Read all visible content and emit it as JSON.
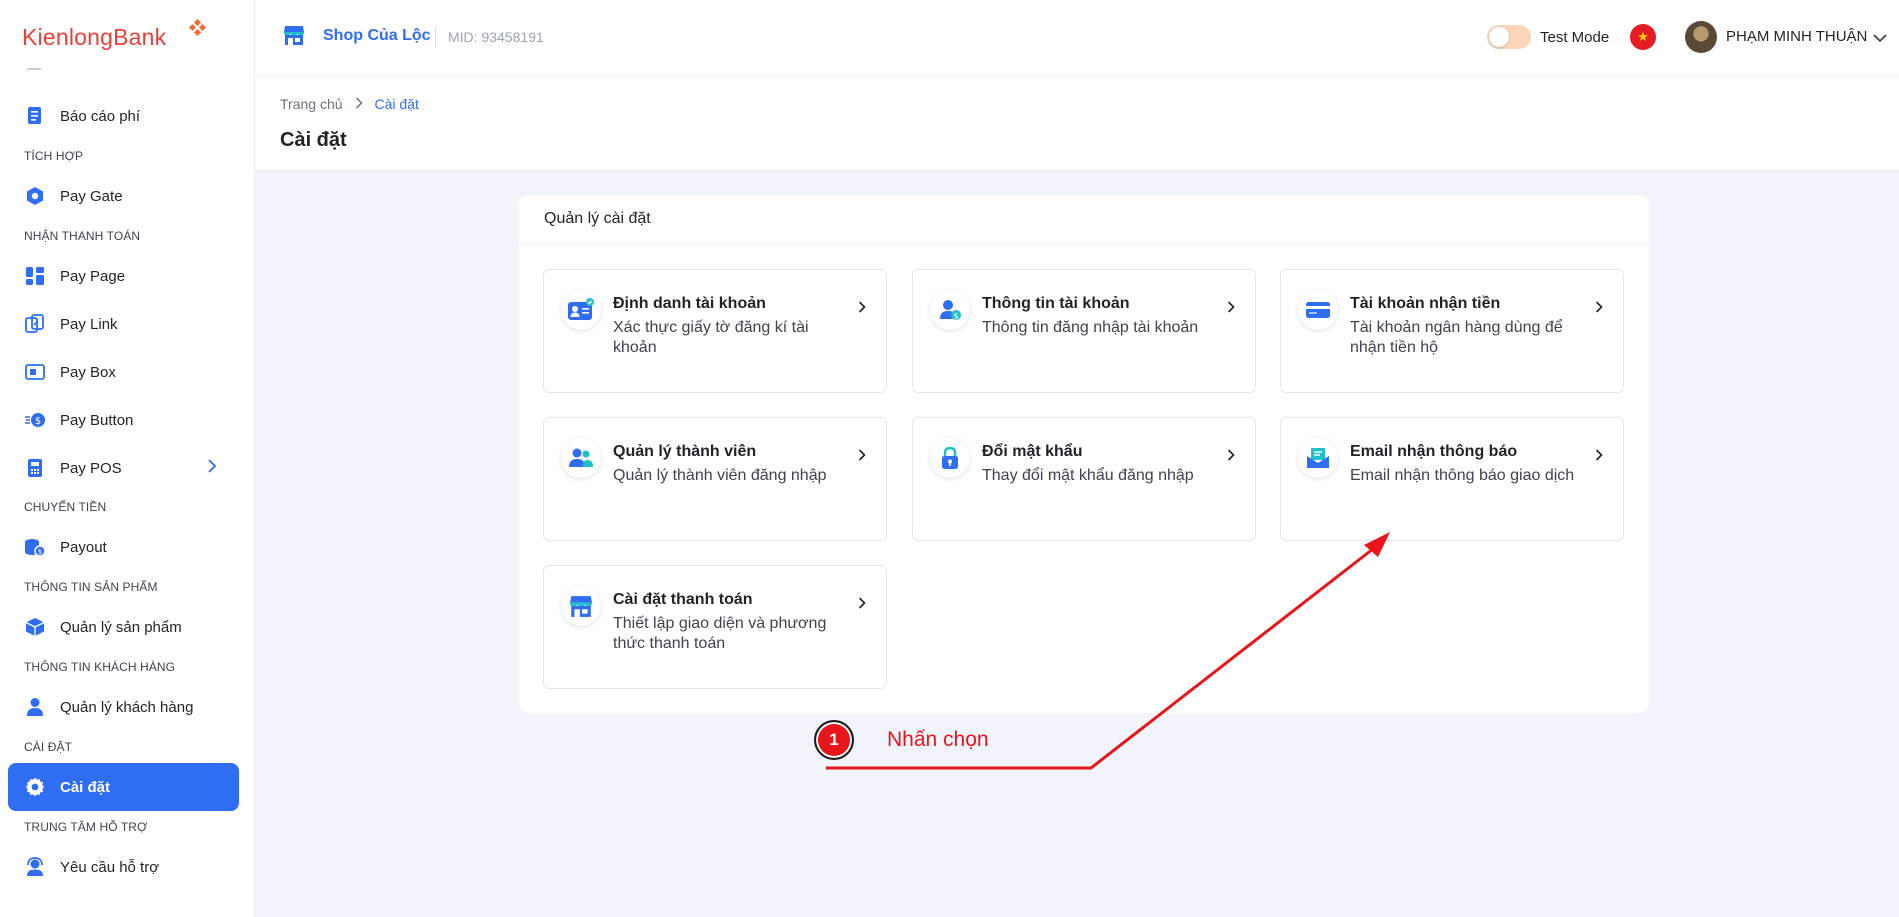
{
  "brand": {
    "part1": "Kienlong",
    "part2": "Bank"
  },
  "sidebar": {
    "items": [
      {
        "key": "bao-cao-phi",
        "label": "Báo cáo phí",
        "icon": "report-icon"
      },
      {
        "key": "pay-gate",
        "label": "Pay Gate",
        "icon": "gate-icon"
      },
      {
        "key": "pay-page",
        "label": "Pay Page",
        "icon": "grid-icon"
      },
      {
        "key": "pay-link",
        "label": "Pay Link",
        "icon": "link-icon"
      },
      {
        "key": "pay-box",
        "label": "Pay Box",
        "icon": "box-icon"
      },
      {
        "key": "pay-button",
        "label": "Pay Button",
        "icon": "coin-icon"
      },
      {
        "key": "pay-pos",
        "label": "Pay POS",
        "icon": "pos-icon"
      },
      {
        "key": "payout",
        "label": "Payout",
        "icon": "payout-icon"
      },
      {
        "key": "quan-ly-san-pham",
        "label": "Quản lý sản phẩm",
        "icon": "cube-icon"
      },
      {
        "key": "quan-ly-khach-hang",
        "label": "Quản lý khách hàng",
        "icon": "user-icon"
      },
      {
        "key": "cai-dat",
        "label": "Cài đặt",
        "icon": "gear-icon"
      },
      {
        "key": "yeu-cau-ho-tro",
        "label": "Yêu cầu hỗ trợ",
        "icon": "support-icon"
      }
    ],
    "sections": {
      "tich_hop": "TÍCH HỢP",
      "nhan_thanh_toan": "NHẬN THANH TOÁN",
      "chuyen_tien": "CHUYỂN TIỀN",
      "thong_tin_san_pham": "THÔNG TIN SẢN PHẨM",
      "thong_tin_khach_hang": "THÔNG TIN KHÁCH HÀNG",
      "cai_dat": "CÀI ĐẶT",
      "trung_tam_ho_tro": "TRUNG TÂM HỖ TRỢ"
    }
  },
  "topbar": {
    "shop_name": "Shop Của Lộc",
    "mid": "MID: 93458191",
    "test_mode_label": "Test Mode",
    "test_mode_on": false,
    "flag_star": "★",
    "user_name": "PHẠM MINH THUẬN"
  },
  "breadcrumb": {
    "home": "Trang chủ",
    "current": "Cài đặt"
  },
  "page_title": "Cài đặt",
  "card": {
    "title": "Quản lý cài đặt",
    "tiles": [
      {
        "title": "Định danh tài khoản",
        "desc": "Xác thực giấy tờ đăng kí tài khoản",
        "icon": "id-card-icon"
      },
      {
        "title": "Thông tin tài khoản",
        "desc": "Thông tin đăng nhập tài khoản",
        "icon": "account-info-icon"
      },
      {
        "title": "Tài khoản nhận tiền",
        "desc": "Tài khoản ngân hàng dùng để nhận tiền hộ",
        "icon": "bank-card-icon"
      },
      {
        "title": "Quản lý thành viên",
        "desc": "Quản lý thành viên đăng nhập",
        "icon": "members-icon"
      },
      {
        "title": "Đổi mật khẩu",
        "desc": "Thay đổi mật khẩu đăng nhập",
        "icon": "lock-icon"
      },
      {
        "title": "Email nhận thông báo",
        "desc": "Email nhận thông báo giao dịch",
        "icon": "email-icon"
      },
      {
        "title": "Cài đặt thanh toán",
        "desc": "Thiết lập giao diện và phương thức thanh toán",
        "icon": "store-icon"
      }
    ]
  },
  "annotation": {
    "step": "1",
    "text": "Nhấn chọn",
    "color": "#e8151b"
  },
  "colors": {
    "accent": "#2f6df2",
    "brand_red": "#e8413a"
  }
}
